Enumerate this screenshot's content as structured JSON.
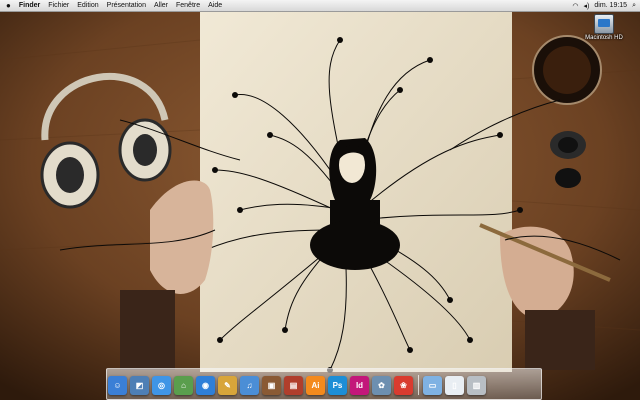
{
  "menubar": {
    "apple_icon": "apple-icon",
    "items": [
      "Finder",
      "Fichier",
      "Edition",
      "Présentation",
      "Aller",
      "Fenêtre",
      "Aide"
    ],
    "clock": "dim. 19:15",
    "status_icons": [
      "wifi-icon",
      "volume-icon",
      "spotlight-icon"
    ]
  },
  "desktop": {
    "volume_label": "Macintosh HD",
    "wallpaper": "photo-artist-drawing-ink-illustration"
  },
  "dock": {
    "items": [
      {
        "name": "finder",
        "glyph": "☺",
        "color": "#3b7fd6"
      },
      {
        "name": "preview",
        "glyph": "◩",
        "color": "#4e7fb5"
      },
      {
        "name": "safari",
        "glyph": "◎",
        "color": "#3f95e6"
      },
      {
        "name": "maps",
        "glyph": "⌂",
        "color": "#5a9e4d"
      },
      {
        "name": "facetime",
        "glyph": "◉",
        "color": "#2f7fd8"
      },
      {
        "name": "notes",
        "glyph": "✎",
        "color": "#d8a53a"
      },
      {
        "name": "itunes",
        "glyph": "♫",
        "color": "#4b8ed6"
      },
      {
        "name": "photo-app",
        "glyph": "▣",
        "color": "#8a5a34"
      },
      {
        "name": "photo-booth",
        "glyph": "▤",
        "color": "#b03e2c"
      },
      {
        "name": "illustrator",
        "glyph": "Ai",
        "color": "#f48a1d"
      },
      {
        "name": "photoshop",
        "glyph": "Ps",
        "color": "#1d8ed6"
      },
      {
        "name": "indesign",
        "glyph": "Id",
        "color": "#c3177a"
      },
      {
        "name": "iphoto",
        "glyph": "✿",
        "color": "#6d8fb0"
      },
      {
        "name": "paw-app",
        "glyph": "❀",
        "color": "#d93b2f"
      },
      {
        "name": "documents-folder",
        "glyph": "▭",
        "color": "#7fb2e3"
      },
      {
        "name": "document-file",
        "glyph": "▯",
        "color": "#e9eef3"
      },
      {
        "name": "trash",
        "glyph": "▥",
        "color": "#b8bec4"
      }
    ]
  },
  "colors": {
    "wood": "#7a4e2a",
    "canvas": "#efe6d2",
    "ink": "#0c0a08"
  }
}
